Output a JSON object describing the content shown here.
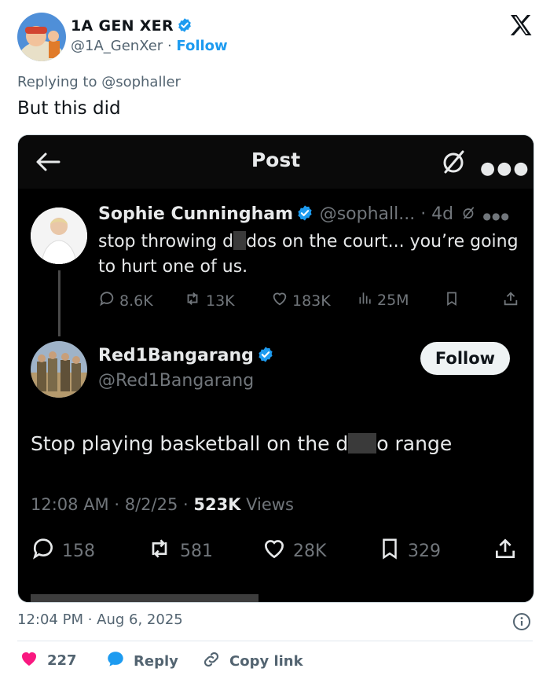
{
  "header": {
    "display_name": "1A GEN XER",
    "handle": "@1A_GenXer",
    "separator": "·",
    "follow_label": "Follow"
  },
  "reply": {
    "replying_to": "Replying to @sophaller",
    "text": "But this did"
  },
  "screenshot": {
    "title": "Post",
    "quoted": {
      "name": "Sophie Cunningham",
      "handle_time": "@sophall... · 4d",
      "text_before": "stop throwing d",
      "text_after": "dos on the court... you’re going to hurt one of us.",
      "replies": "8.6K",
      "reposts": "13K",
      "likes": "183K",
      "views": "25M"
    },
    "main": {
      "name": "Red1Bangarang",
      "handle": "@Red1Bangarang",
      "follow_label": "Follow",
      "text_before": "Stop playing basketball on the d",
      "text_after": "o range",
      "time": "12:08 AM",
      "date": "8/2/25",
      "views_count": "523K",
      "views_label": "Views",
      "replies": "158",
      "reposts": "581",
      "likes": "28K",
      "bookmarks": "329"
    }
  },
  "timestamp": "12:04 PM · Aug 6, 2025",
  "footer": {
    "likes": "227",
    "reply_label": "Reply",
    "copy_label": "Copy link"
  },
  "colors": {
    "accent": "#1d9bf0",
    "heart": "#f91880",
    "dark_bg": "#000000",
    "muted": "#536471"
  }
}
